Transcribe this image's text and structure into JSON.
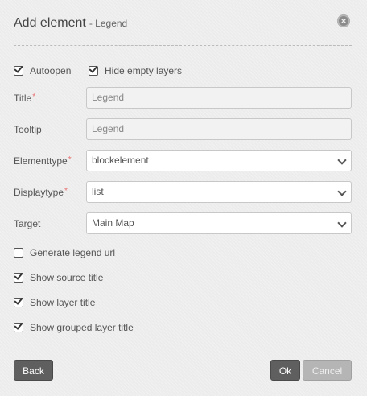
{
  "dialog": {
    "title": "Add element",
    "subtitle": "- Legend",
    "close_icon": "close-icon"
  },
  "options_top": {
    "autoopen": {
      "label": "Autoopen",
      "checked": true
    },
    "hide_empty": {
      "label": "Hide empty layers",
      "checked": true
    }
  },
  "fields": {
    "title": {
      "label": "Title",
      "required": "*",
      "value": "Legend"
    },
    "tooltip": {
      "label": "Tooltip",
      "value": "Legend"
    },
    "elementtype": {
      "label": "Elementtype",
      "required": "*",
      "value": "blockelement"
    },
    "displaytype": {
      "label": "Displaytype",
      "required": "*",
      "value": "list"
    },
    "target": {
      "label": "Target",
      "value": "Main Map"
    }
  },
  "options_bottom": {
    "generate_url": {
      "label": "Generate legend url",
      "checked": false
    },
    "source_title": {
      "label": "Show source title",
      "checked": true
    },
    "layer_title": {
      "label": "Show layer title",
      "checked": true
    },
    "grouped_title": {
      "label": "Show grouped layer title",
      "checked": true
    }
  },
  "buttons": {
    "back": "Back",
    "ok": "Ok",
    "cancel": "Cancel"
  }
}
